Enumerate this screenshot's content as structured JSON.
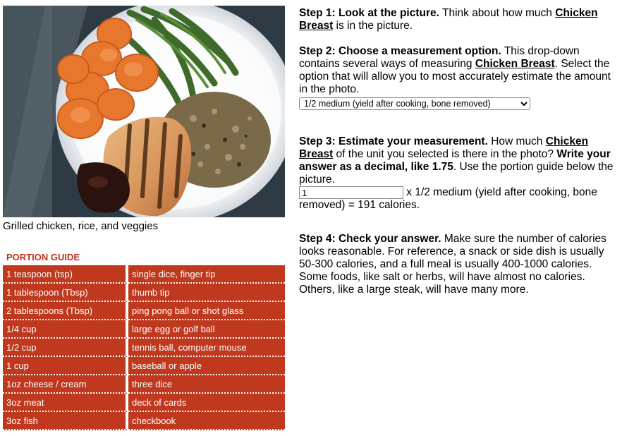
{
  "photo": {
    "caption": "Grilled chicken, rice, and veggies"
  },
  "portion_guide": {
    "title": "PORTION GUIDE",
    "rows": [
      [
        "1 teaspoon (tsp)",
        "single dice, finger tip"
      ],
      [
        "1 tablespoon (Tbsp)",
        "thumb tip"
      ],
      [
        "2 tablespoons (Tbsp)",
        "ping pong ball or shot glass"
      ],
      [
        "1/4 cup",
        "large egg or golf ball"
      ],
      [
        "1/2 cup",
        "tennis ball, computer mouse"
      ],
      [
        "1 cup",
        "baseball or apple"
      ],
      [
        "1oz cheese / cream",
        "three dice"
      ],
      [
        "3oz meat",
        "deck of cards"
      ],
      [
        "3oz fish",
        "checkbook"
      ]
    ]
  },
  "food_name": "Chicken Breast",
  "step1": {
    "heading": "Step 1: Look at the picture.",
    "text_a": " Think about how much ",
    "text_b": " is in the picture."
  },
  "step2": {
    "heading": "Step 2: Choose a measurement option.",
    "text_a": " This drop-down contains several ways of measuring ",
    "text_b": ". Select the option that will allow you to most accurately estimate the amount in the photo.",
    "selected_option": "1/2 medium (yield after cooking, bone removed)"
  },
  "step3": {
    "heading": "Step 3: Estimate your measurement.",
    "text_a": " How much ",
    "text_b": " of the unit you selected is there in the photo? ",
    "bold_instruction": "Write your answer as a decimal, like 1.75",
    "text_c": ". Use the portion guide below the picture.",
    "amount_value": "1",
    "result_text": " x 1/2 medium (yield after cooking, bone removed) = 191 calories."
  },
  "step4": {
    "heading": "Step 4: Check your answer.",
    "text": " Make sure the number of calories looks reasonable. For reference, a snack or side dish is usually 50-300 calories, and a full meal is usually 400-1000 calories. Some foods, like salt or herbs, will have almost no calories. Others, like a large steak, will have many more."
  }
}
